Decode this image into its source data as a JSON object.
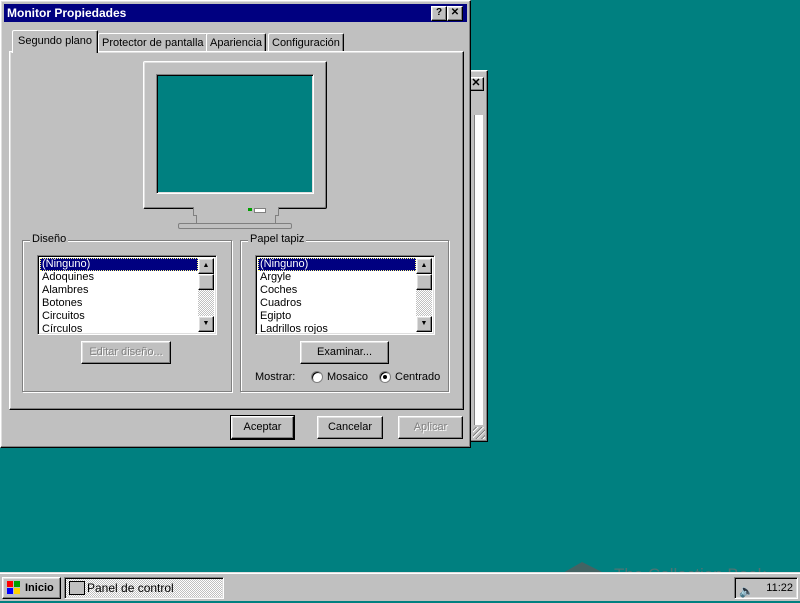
{
  "background_window": {
    "close_glyph": "✕"
  },
  "dialog": {
    "title": "Monitor Propiedades",
    "help_glyph": "?",
    "close_glyph": "✕",
    "tabs": [
      {
        "label": "Segundo plano",
        "active": true
      },
      {
        "label": "Protector de pantalla"
      },
      {
        "label": "Apariencia"
      },
      {
        "label": "Configuración"
      }
    ],
    "diseno": {
      "legend": "Diseño",
      "items": [
        "(Ninguno)",
        "Adoquines",
        "Alambres",
        "Botones",
        "Circuitos",
        "Círculos"
      ],
      "selected_index": 0,
      "edit_button": "Editar diseño..."
    },
    "papel": {
      "legend": "Papel tapiz",
      "items": [
        "(Ninguno)",
        "Argyle",
        "Coches",
        "Cuadros",
        "Egipto",
        "Ladrillos rojos"
      ],
      "selected_index": 0,
      "browse_button": "Examinar...",
      "mostrar_label": "Mostrar:",
      "options": [
        {
          "label": "Mosaico",
          "checked": false
        },
        {
          "label": "Centrado",
          "checked": true
        }
      ]
    },
    "buttons": {
      "ok": "Aceptar",
      "cancel": "Cancelar",
      "apply": "Aplicar"
    }
  },
  "taskbar": {
    "start_label": "Inicio",
    "task_label": "Panel de control",
    "clock": "11:22",
    "volume_icon": "speaker-icon"
  },
  "watermark": {
    "text": "The Collection Book"
  },
  "colors": {
    "desktop": "#008080",
    "titlebar": "#000080",
    "face": "#c0c0c0"
  }
}
